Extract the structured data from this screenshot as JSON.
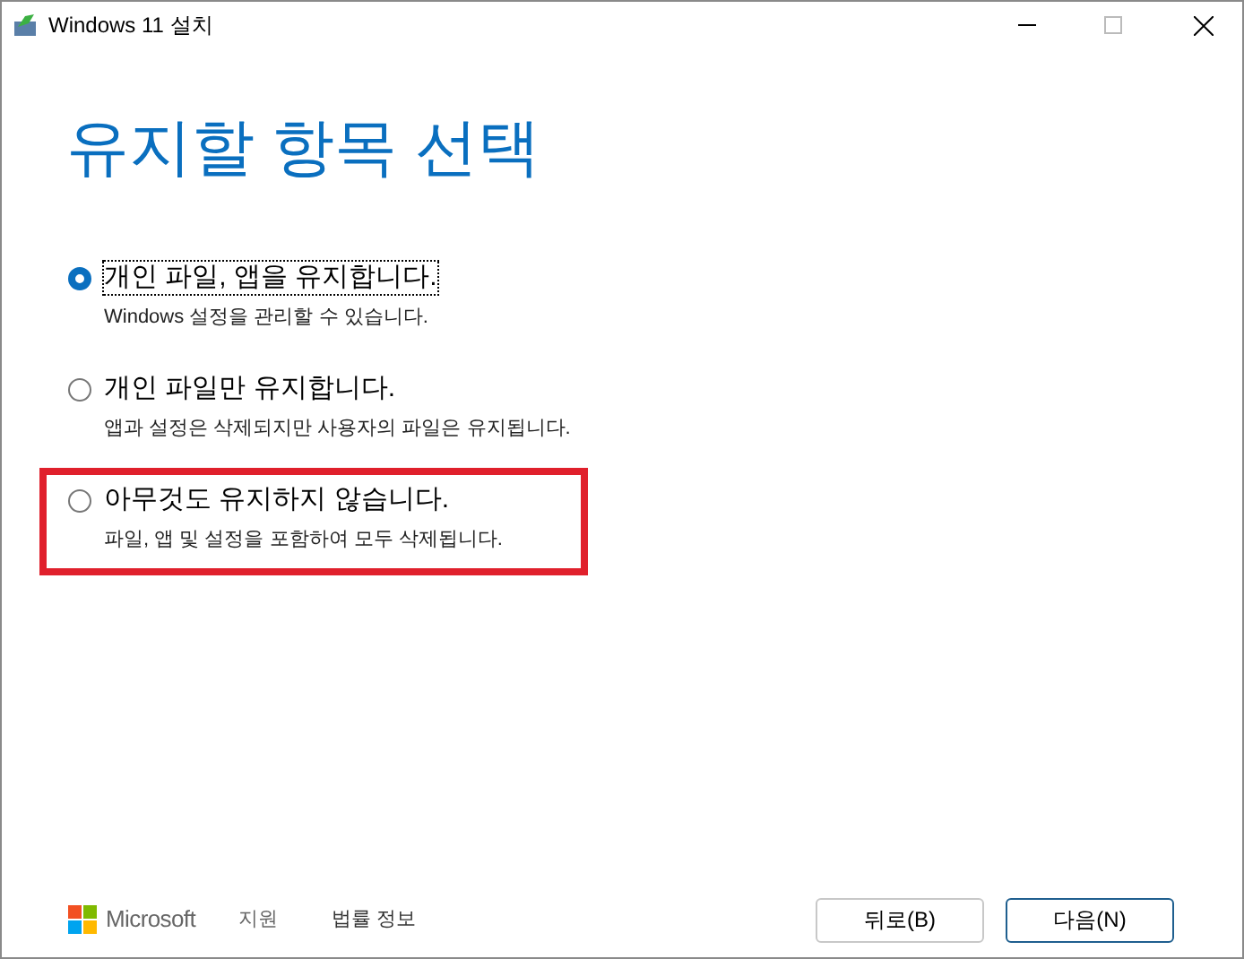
{
  "window": {
    "title": "Windows 11 설치"
  },
  "heading": "유지할 항목 선택",
  "options": [
    {
      "label": "개인 파일, 앱을 유지합니다.",
      "description": "Windows 설정을 관리할 수 있습니다.",
      "selected": true,
      "focused": true,
      "highlighted": false
    },
    {
      "label": "개인 파일만 유지합니다.",
      "description": "앱과 설정은 삭제되지만 사용자의 파일은 유지됩니다.",
      "selected": false,
      "focused": false,
      "highlighted": false
    },
    {
      "label": "아무것도 유지하지 않습니다.",
      "description": "파일, 앱 및 설정을 포함하여 모두 삭제됩니다.",
      "selected": false,
      "focused": false,
      "highlighted": true
    }
  ],
  "footer": {
    "brand": "Microsoft",
    "links": [
      "지원",
      "법률 정보"
    ]
  },
  "buttons": [
    {
      "label": "뒤로(B)",
      "default": false
    },
    {
      "label": "다음(N)",
      "default": true
    }
  ]
}
